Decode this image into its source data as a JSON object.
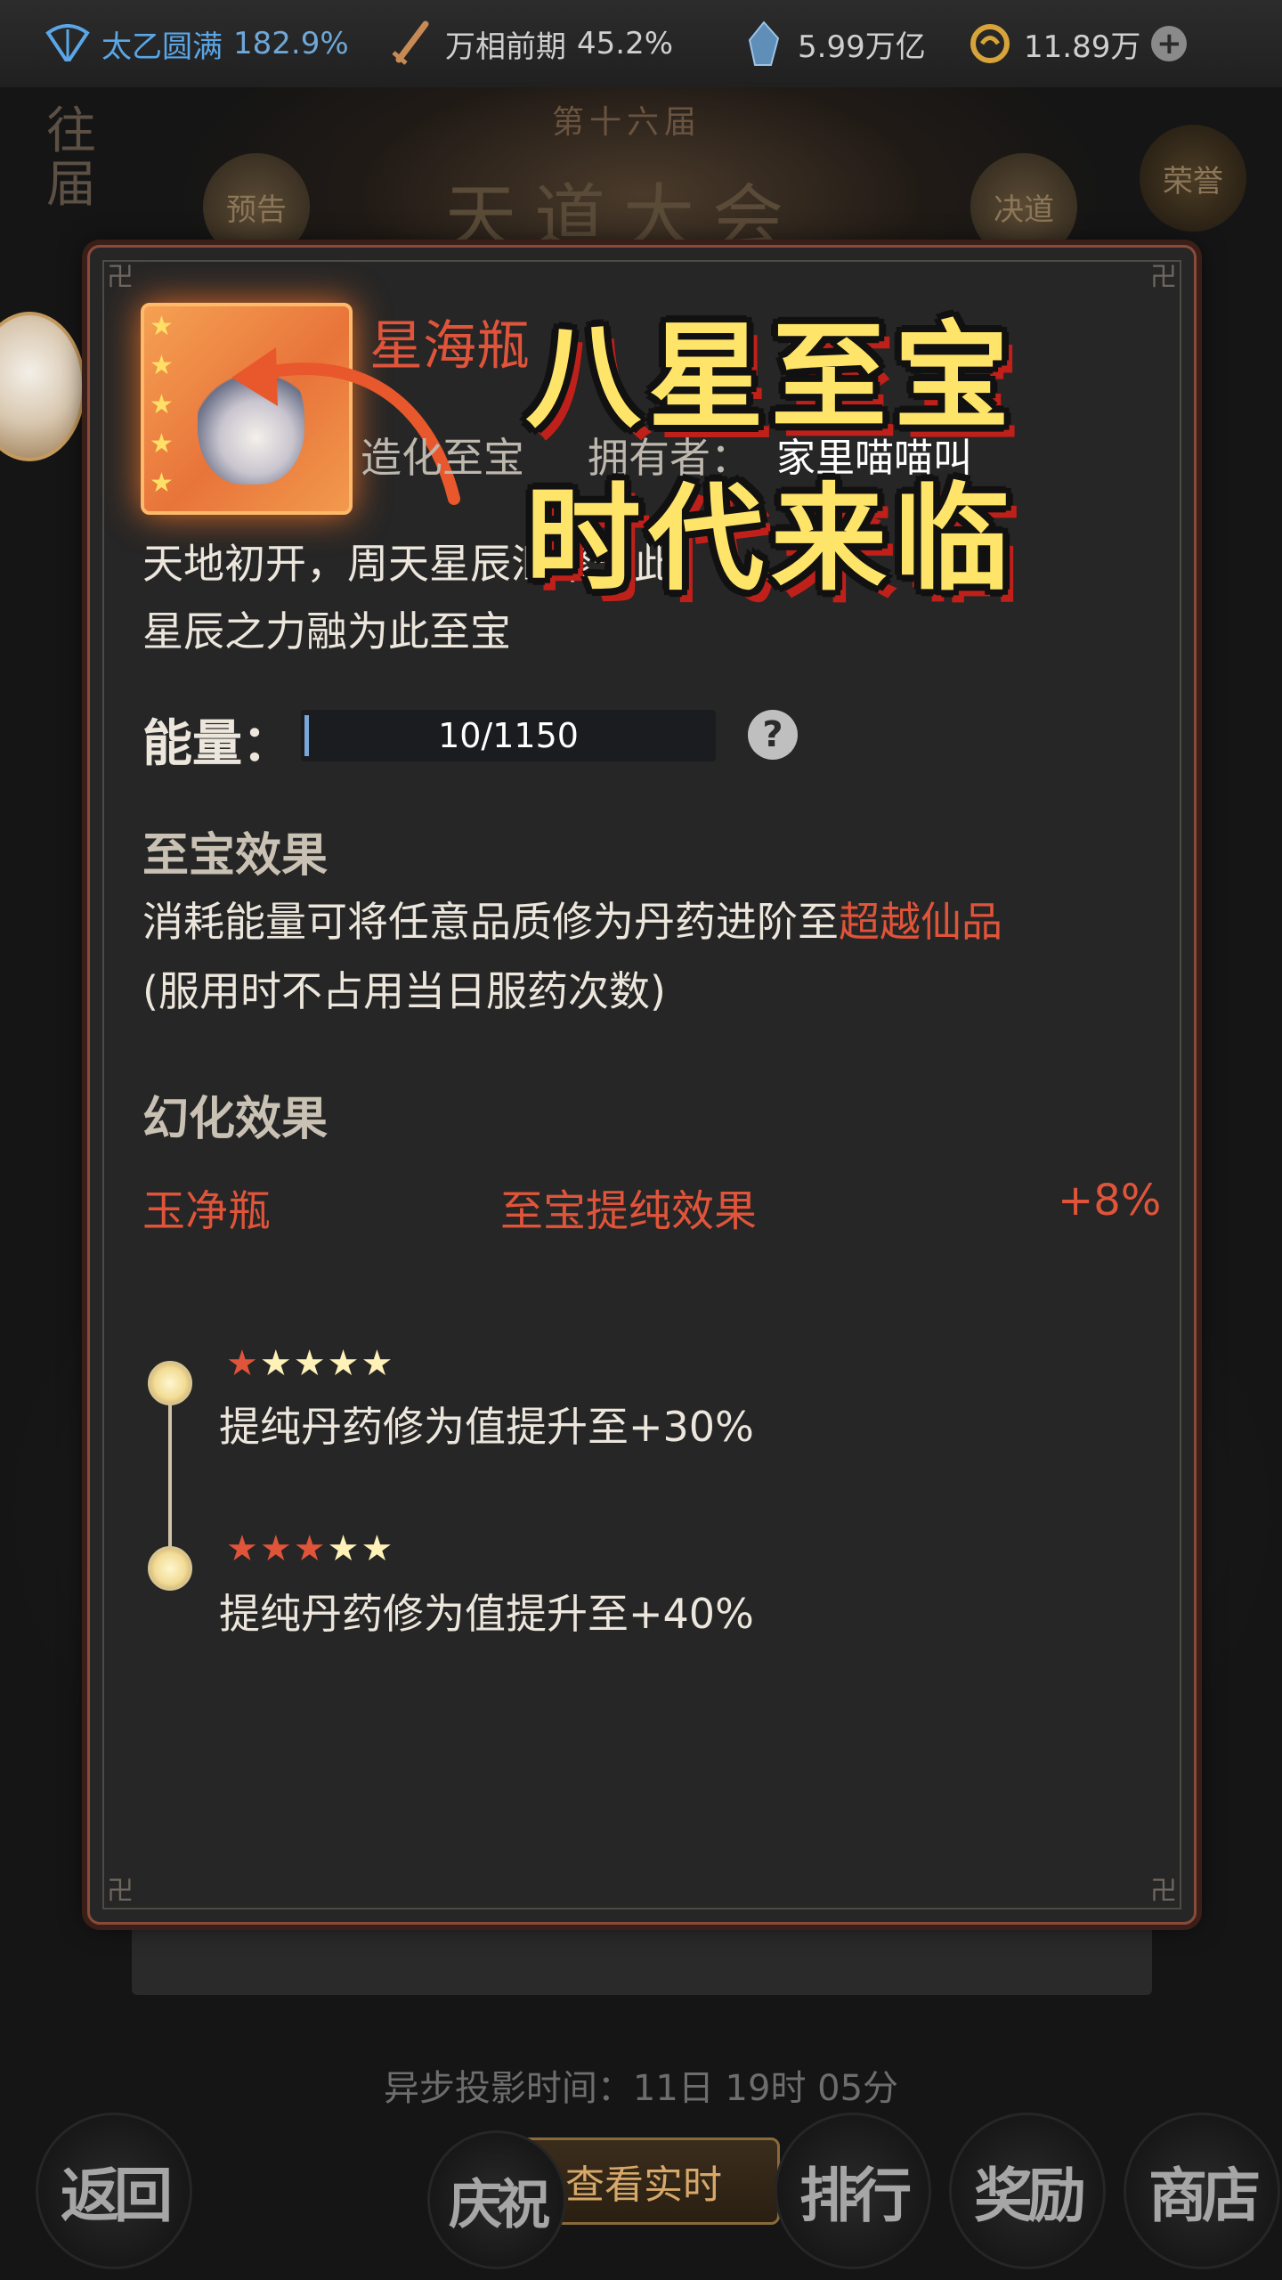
{
  "topbar": {
    "cultivation_name": "太乙圆满",
    "cultivation_value": "182.9%",
    "weapon_stage": "万相前期",
    "weapon_value": "45.2%",
    "crystal": "5.99万亿",
    "currency": "11.89万",
    "plus": "+"
  },
  "background": {
    "past_label": "往届",
    "edition": "第十六届",
    "event_title": "天道大会",
    "preview": "预告",
    "final": "决道",
    "honor": "荣誉",
    "async_time": "异步投影时间：11日 19时 05分",
    "realtime_button": "查看实时",
    "nav": {
      "back": "返回",
      "celebrate": "庆祝",
      "ranking": "排行",
      "reward": "奖励",
      "shop": "商店"
    }
  },
  "modal": {
    "item_name": "星海瓶",
    "item_stars": [
      "★",
      "★",
      "★",
      "★",
      "★"
    ],
    "item_type": "造化至宝",
    "owner_label": "拥有者：",
    "owner_name": "家里喵喵叫",
    "description": "天地初开，周天星辰汇聚于此，星辰之力融为此至宝",
    "desc_line1": "天地初开，周天星辰汇聚于此，",
    "desc_line2": "星辰之力融为此至宝",
    "energy_label": "能量：",
    "energy_value": "10/1150",
    "energy_fraction": 0.0087,
    "help_icon": "?",
    "effect_title": "至宝效果",
    "effect_line1_prefix": "消耗能量可将任意品质修为丹药进阶至",
    "effect_line1_highlight": "超越仙品",
    "effect_line2": "(服用时不占用当日服药次数)",
    "transform_title": "幻化效果",
    "transform": {
      "name": "玉净瓶",
      "effect": "至宝提纯效果",
      "bonus": "+8%"
    },
    "tiers": [
      {
        "red_stars": "★",
        "gold_stars": "★★★★",
        "text": "提纯丹药修为值提升至+30%"
      },
      {
        "red_stars": "★★★",
        "gold_stars": "★★",
        "text": "提纯丹药修为值提升至+40%"
      }
    ]
  },
  "overlay": {
    "line1": "八星至宝",
    "line2": "时代来临"
  },
  "colors": {
    "accent_red": "#e0543a",
    "title_yellow": "#ffe46a",
    "cultivation_blue": "#5aa6e6"
  }
}
